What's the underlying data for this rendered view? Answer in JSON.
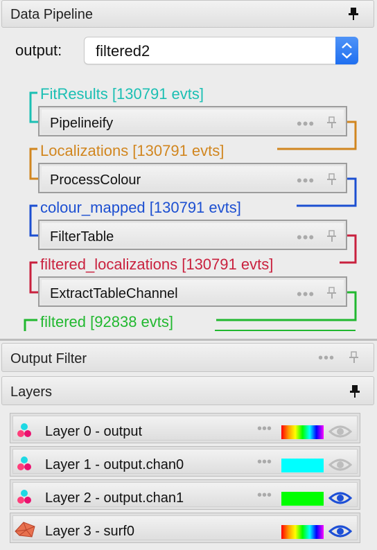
{
  "data_pipeline": {
    "title": "Data Pipeline",
    "output_label": "output:",
    "output_selected": "filtered2",
    "datasources": [
      {
        "label": "FitResults [130791 evts]",
        "color": "#1bbfb3"
      },
      {
        "label": "Localizations [130791 evts]",
        "color": "#d1861f"
      },
      {
        "label": "colour_mapped [130791 evts]",
        "color": "#1c4fd1"
      },
      {
        "label": "filtered_localizations [130791 evts]",
        "color": "#c9213e"
      },
      {
        "label": "filtered [92838 evts]",
        "color": "#21b82f"
      }
    ],
    "modules": [
      {
        "label": "Pipelineify"
      },
      {
        "label": "ProcessColour"
      },
      {
        "label": "FilterTable"
      },
      {
        "label": "ExtractTableChannel"
      }
    ]
  },
  "output_filter": {
    "title": "Output Filter"
  },
  "layers": {
    "title": "Layers",
    "items": [
      {
        "label": "Layer 0 - output",
        "icon": "points-icon",
        "lut": "rainbow",
        "visible": false
      },
      {
        "label": "Layer 1 - output.chan0",
        "icon": "points-icon",
        "lut": "#00ffff",
        "visible": false
      },
      {
        "label": "Layer 2 - output.chan1",
        "icon": "points-icon",
        "lut": "#00ff00",
        "visible": true
      },
      {
        "label": "Layer 3 - surf0",
        "icon": "surface-icon",
        "lut": "rainbow",
        "visible": true
      }
    ]
  },
  "colors": {
    "eye_visible": "#1d4fd6",
    "eye_hidden": "#bdbdbd",
    "accent": "#2a7af5"
  }
}
